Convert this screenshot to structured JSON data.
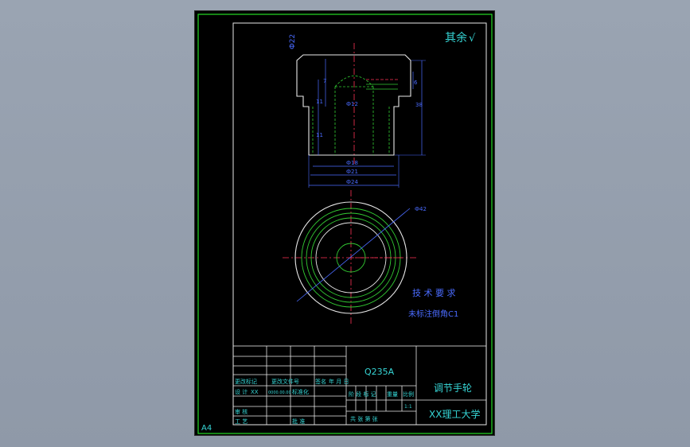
{
  "sheet": {
    "paper_size": "A4",
    "roughness_note": "其余",
    "roughness_value": "√"
  },
  "part_view": {
    "top_label": "Ф22",
    "dimensions": {
      "d1": "Ф18",
      "d2": "Ф21",
      "d3": "Ф24",
      "inner": "Ф12",
      "radius": "Ф42",
      "h1": "11",
      "h2": "11",
      "h3": "7",
      "total": "38",
      "side_small": "6"
    }
  },
  "tech_req": {
    "title": "技 术 要 求",
    "note": "未标注倒角C1"
  },
  "title_block": {
    "material": "Q235A",
    "part_name": "调节手轮",
    "school": "XX理工大学",
    "row_labels": [
      "更改标记",
      "更改文件号",
      "签名",
      "年 月 日"
    ],
    "design_label": "设 计",
    "design_name": "XX",
    "design_date": "0000.00.00",
    "standardize_label": "标准化",
    "review_label": "审 核",
    "process_label": "工 艺",
    "approve_label": "批 准",
    "stage_labels": [
      "阶 段 标 记",
      "重量",
      "比例"
    ],
    "scale": "1:1",
    "sheets_label": "共 张 第 张"
  }
}
